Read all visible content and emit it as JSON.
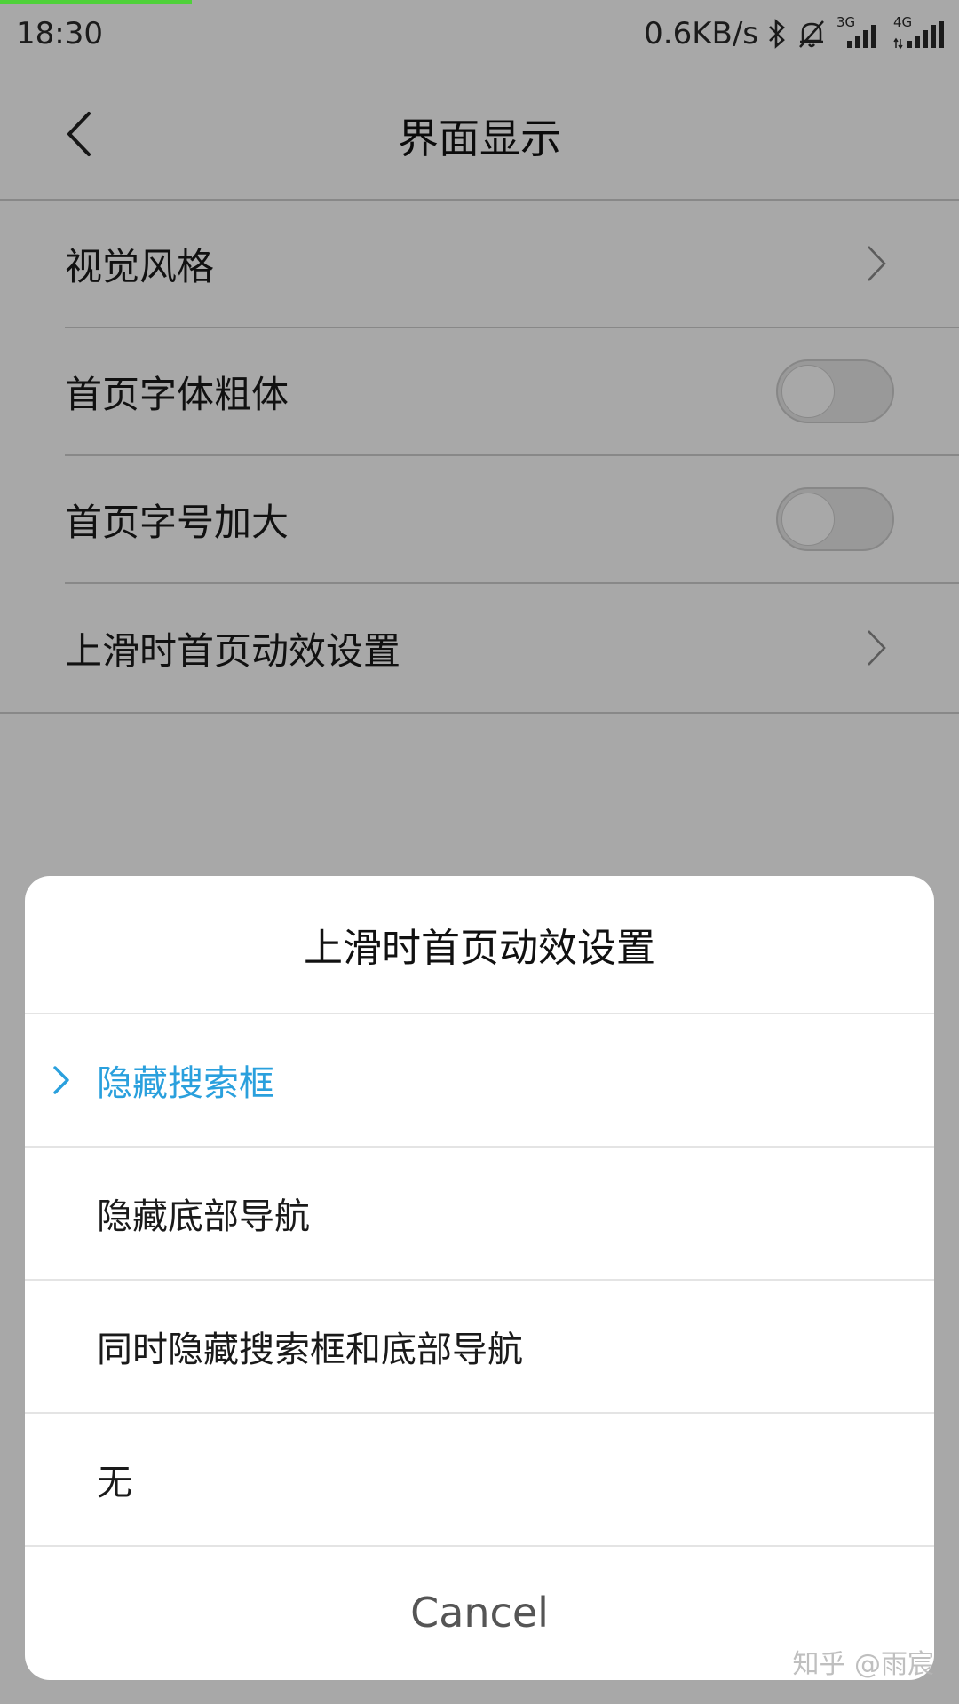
{
  "status_bar": {
    "time": "18:30",
    "net_speed": "0.6KB/s",
    "network_1": "3G",
    "network_2": "4G"
  },
  "header": {
    "title": "界面显示"
  },
  "settings": {
    "items": [
      {
        "label": "视觉风格"
      },
      {
        "label": "首页字体粗体",
        "toggle_on": false
      },
      {
        "label": "首页字号加大",
        "toggle_on": false
      },
      {
        "label": "上滑时首页动效设置"
      }
    ]
  },
  "dialog": {
    "title": "上滑时首页动效设置",
    "options": [
      {
        "label": "隐藏搜索框",
        "selected": true
      },
      {
        "label": "隐藏底部导航",
        "selected": false
      },
      {
        "label": "同时隐藏搜索框和底部导航",
        "selected": false
      },
      {
        "label": "无",
        "selected": false
      }
    ],
    "cancel_label": "Cancel"
  },
  "watermark": "知乎 @雨宸",
  "colors": {
    "accent": "#2aa0dd",
    "progress": "#4fd13a"
  }
}
